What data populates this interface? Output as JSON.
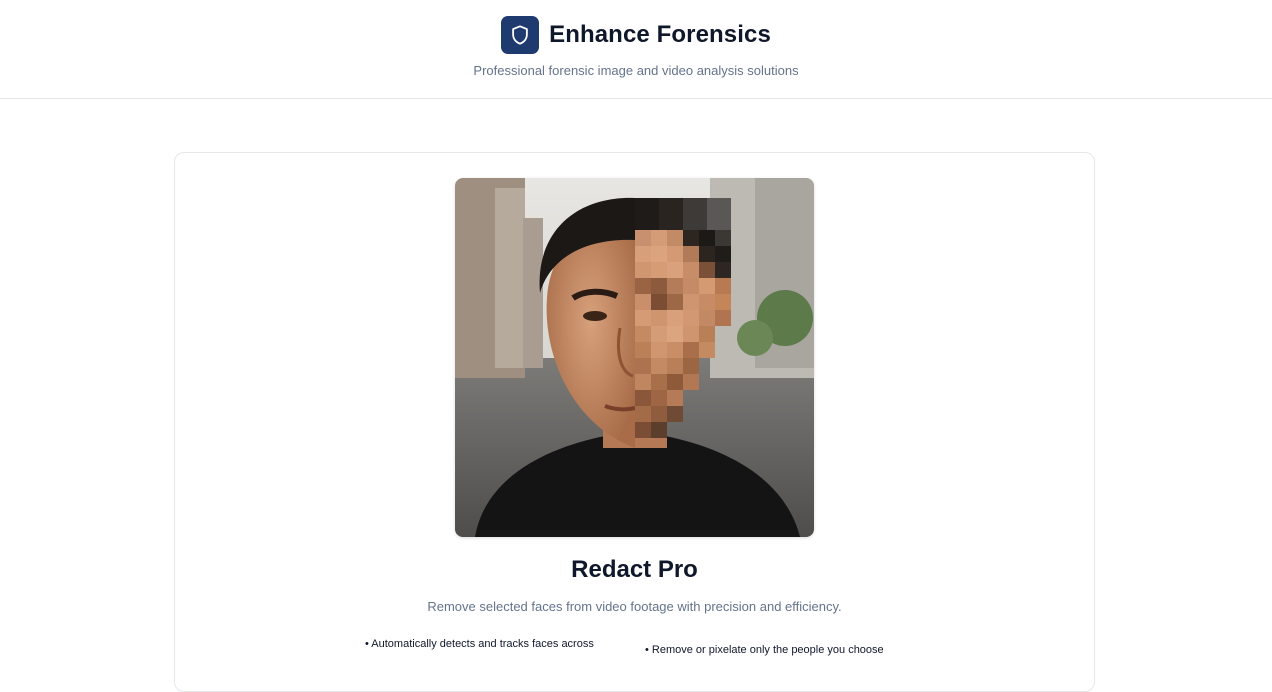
{
  "header": {
    "title": "Enhance Forensics",
    "tagline": "Professional forensic image and video analysis solutions",
    "logo_icon": "shield-icon",
    "logo_color": "#1e3a6e"
  },
  "product": {
    "image_alt": "Portrait of a man with the right half of his face pixelated",
    "title": "Redact Pro",
    "description": "Remove selected faces from video footage with precision and efficiency.",
    "features": [
      "• Automatically detects and tracks faces across",
      "• Remove or pixelate only the people you choose"
    ]
  }
}
